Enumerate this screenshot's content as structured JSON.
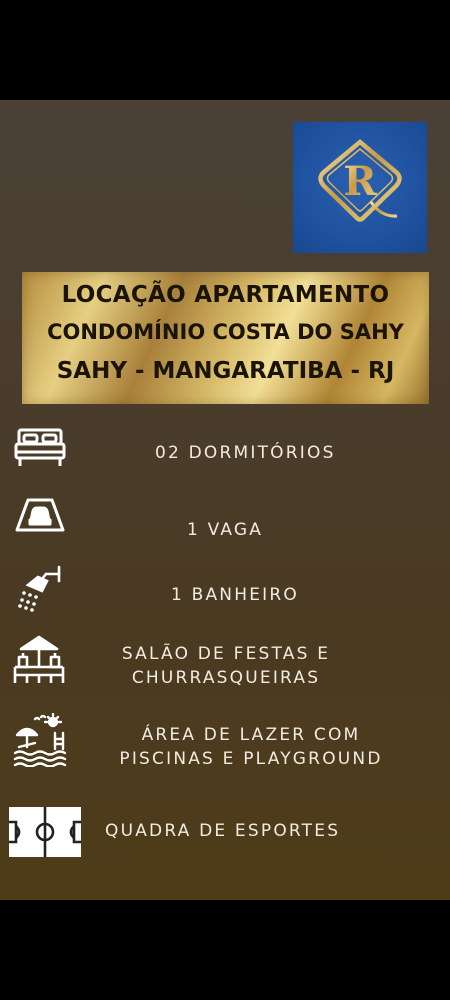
{
  "banner": {
    "line1": "LOCAÇÃO APARTAMENTO",
    "line2": "CONDOMÍNIO COSTA DO SAHY",
    "line3": "SAHY - MANGARATIBA - RJ"
  },
  "features": [
    {
      "icon": "bed-icon",
      "text": "02 DORMITÓRIOS"
    },
    {
      "icon": "car-parking-icon",
      "text": "1 VAGA"
    },
    {
      "icon": "shower-icon",
      "text": "1 BANHEIRO"
    },
    {
      "icon": "kiosk-grill-icon",
      "line1": "SALÃO DE FESTAS E",
      "line2": "CHURRASQUEIRAS"
    },
    {
      "icon": "pool-leisure-icon",
      "line1": "ÁREA DE LAZER COM",
      "line2": "PISCINAS E PLAYGROUND"
    },
    {
      "icon": "sports-court-icon",
      "text": "QUADRA DE ESPORTES"
    }
  ],
  "colors": {
    "background_top": "#4b4137",
    "background_bottom": "#4e3c18",
    "logo_blue": "#1f56a4",
    "gold": "#d9bd6b",
    "text": "#f1ece2"
  }
}
